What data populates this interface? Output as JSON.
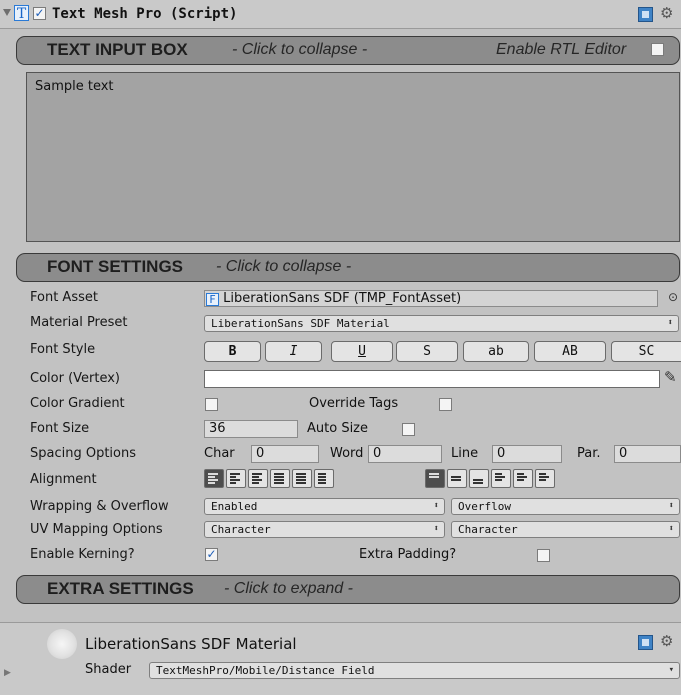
{
  "component": {
    "title": "Text Mesh Pro (Script)",
    "t_icon_glyph": "T",
    "icons": [
      "fold-arrow-icon",
      "text-component-icon",
      "help-book-icon",
      "gear-icon"
    ]
  },
  "text_input_box": {
    "title": "TEXT INPUT BOX",
    "hint": "- Click to collapse -",
    "rtl_label": "Enable RTL Editor",
    "value": "Sample text"
  },
  "font_settings": {
    "title": "FONT SETTINGS",
    "hint": "- Click to collapse -",
    "labels": {
      "font_asset": "Font Asset",
      "material_preset": "Material Preset",
      "font_style": "Font Style",
      "color_vertex": "Color (Vertex)",
      "color_gradient": "Color Gradient",
      "font_size": "Font Size",
      "spacing_options": "Spacing Options",
      "alignment": "Alignment",
      "wrapping": "Wrapping & Overflow",
      "uv_mapping": "UV Mapping Options",
      "kerning": "Enable Kerning?"
    },
    "font_asset_value": "LiberationSans SDF (TMP_FontAsset)",
    "font_asset_icon_glyph": "F",
    "material_preset_value": "LiberationSans SDF Material",
    "style_buttons": [
      "B",
      "I",
      "U",
      "S",
      "ab",
      "AB",
      "SC"
    ],
    "override_tags_label": "Override Tags",
    "font_size_value": "36",
    "auto_size_label": "Auto Size",
    "spacing": {
      "char_label": "Char",
      "char_value": "0",
      "word_label": "Word",
      "word_value": "0",
      "line_label": "Line",
      "line_value": "0",
      "par_label": "Par.",
      "par_value": "0"
    },
    "wrapping_value": "Enabled",
    "overflow_value": "Overflow",
    "uv_horizontal_value": "Character",
    "uv_vertical_value": "Character",
    "extra_padding_label": "Extra Padding?",
    "kerning_checked": true
  },
  "extra_settings": {
    "title": "EXTRA SETTINGS",
    "hint": "- Click to expand -"
  },
  "material": {
    "name": "LiberationSans SDF Material",
    "shader_label": "Shader",
    "shader_value": "TextMeshPro/Mobile/Distance Field"
  }
}
